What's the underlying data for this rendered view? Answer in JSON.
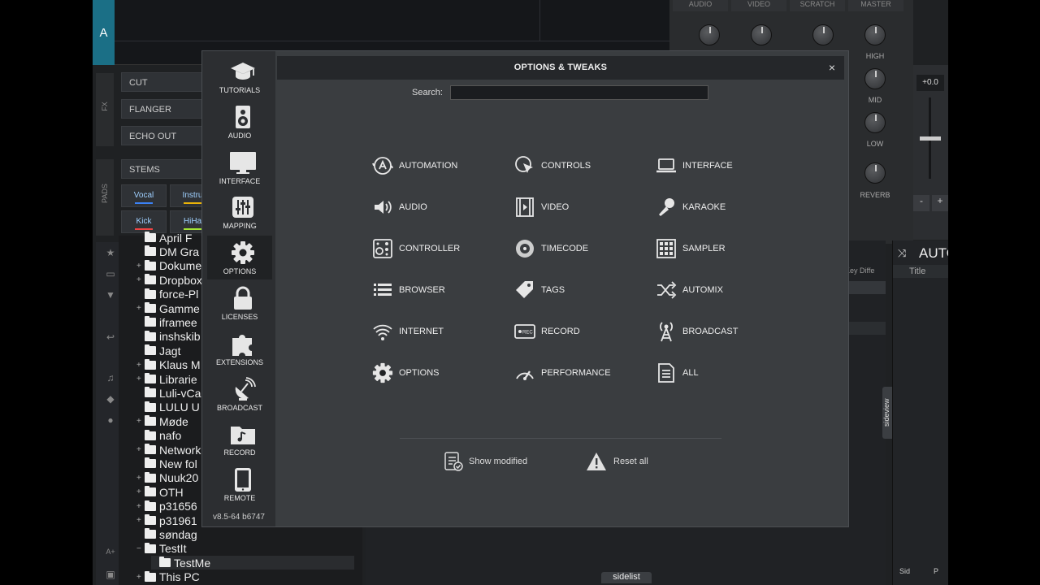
{
  "app": {
    "deck_label": "A",
    "mixer_tabs": [
      "AUDIO",
      "VIDEO",
      "SCRATCH",
      "MASTER"
    ],
    "eq_labels": [
      "HIGH",
      "MID",
      "LOW",
      "REVERB"
    ],
    "pitch_value": "+0.0",
    "pitch_minus": "-",
    "pitch_plus": "+",
    "fx_label": "FX",
    "pads_label": "PADS",
    "fx_buttons": [
      "CUT",
      "FLANGER",
      "ECHO OUT",
      "STEMS"
    ],
    "pads": [
      {
        "label": "Vocal",
        "color": "#3b82f6"
      },
      {
        "label": "Instru",
        "color": "#eab308"
      },
      {
        "label": "Kick",
        "color": "#ef4444"
      },
      {
        "label": "HiHa",
        "color": "#a3e635"
      }
    ],
    "folders": [
      "April F",
      "DM Gra",
      "Dokumenta",
      "Dropbox",
      "force-Pl",
      "Gamme",
      "iframee",
      "inshskib",
      "Jagt",
      "Klaus M",
      "Librarie",
      "Luli-vCa",
      "LULU U",
      "Møde",
      "nafo",
      "Network",
      "New fol",
      "Nuuk20",
      "OTH",
      "p31656",
      "p31961",
      "søndag",
      "TestIt",
      "TestMe",
      "This PC"
    ],
    "browser_header": "Key Diffe",
    "side_header": "AUTO",
    "side_col": "Title",
    "sideview_tab": "sideview",
    "sidelist_tab": "sidelist",
    "bottom_right": [
      "Sid",
      "P"
    ],
    "a_plus": "A+"
  },
  "dialog": {
    "title": "OPTIONS & TWEAKS",
    "close": "×",
    "search_label": "Search:",
    "search_value": "",
    "version": "v8.5-64 b6747",
    "sidebar": [
      {
        "label": "TUTORIALS",
        "icon": "graduation-cap-icon"
      },
      {
        "label": "AUDIO",
        "icon": "speaker-icon"
      },
      {
        "label": "INTERFACE",
        "icon": "monitor-icon"
      },
      {
        "label": "MAPPING",
        "icon": "sliders-icon"
      },
      {
        "label": "OPTIONS",
        "icon": "gear-icon",
        "active": true
      },
      {
        "label": "LICENSES",
        "icon": "lock-icon"
      },
      {
        "label": "EXTENSIONS",
        "icon": "puzzle-icon"
      },
      {
        "label": "BROADCAST",
        "icon": "broadcast-dish-icon"
      },
      {
        "label": "RECORD",
        "icon": "music-folder-icon"
      },
      {
        "label": "REMOTE",
        "icon": "tablet-icon"
      }
    ],
    "categories": [
      {
        "label": "AUTOMATION",
        "icon": "automation-icon"
      },
      {
        "label": "CONTROLS",
        "icon": "cursor-icon"
      },
      {
        "label": "INTERFACE",
        "icon": "laptop-icon"
      },
      {
        "label": "AUDIO",
        "icon": "volume-icon"
      },
      {
        "label": "VIDEO",
        "icon": "film-icon"
      },
      {
        "label": "KARAOKE",
        "icon": "microphone-icon"
      },
      {
        "label": "CONTROLLER",
        "icon": "controller-icon"
      },
      {
        "label": "TIMECODE",
        "icon": "vinyl-icon"
      },
      {
        "label": "SAMPLER",
        "icon": "grid-icon"
      },
      {
        "label": "BROWSER",
        "icon": "list-icon"
      },
      {
        "label": "TAGS",
        "icon": "tag-icon"
      },
      {
        "label": "AUTOMIX",
        "icon": "shuffle-icon"
      },
      {
        "label": "INTERNET",
        "icon": "wifi-icon"
      },
      {
        "label": "RECORD",
        "icon": "rec-icon"
      },
      {
        "label": "BROADCAST",
        "icon": "antenna-icon"
      },
      {
        "label": "OPTIONS",
        "icon": "gear-icon"
      },
      {
        "label": "PERFORMANCE",
        "icon": "gauge-icon"
      },
      {
        "label": "ALL",
        "icon": "document-icon"
      }
    ],
    "show_modified": "Show modified",
    "reset_all": "Reset all"
  }
}
